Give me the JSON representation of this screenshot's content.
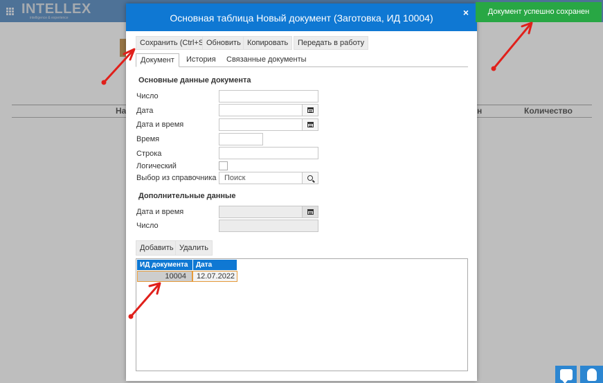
{
  "app": {
    "logo": "INTELLEX",
    "logo_tagline": "intelligence & experience"
  },
  "background": {
    "col_name_fragment": "На",
    "col_fragment_2": "н",
    "col_quantity": "Количество"
  },
  "modal": {
    "title": "Основная таблица Новый документ (Заготовка, ИД 10004)",
    "close": "×",
    "toolbar": {
      "save": "Сохранить (Ctrl+S)",
      "refresh": "Обновить",
      "copy": "Копировать",
      "send": "Передать в работу"
    },
    "tabs": [
      "Документ",
      "История",
      "Связанные документы"
    ],
    "main_section": "Основные данные документа",
    "fields": {
      "number": "Число",
      "date": "Дата",
      "datetime": "Дата и время",
      "time": "Время",
      "string": "Строка",
      "logical": "Логический",
      "lookup": "Выбор из справочника"
    },
    "search_placeholder": "Поиск",
    "extra_section": "Дополнительные данные",
    "extra_fields": {
      "datetime": "Дата и время",
      "number": "Число"
    },
    "grid_buttons": {
      "add": "Добавить",
      "delete": "Удалить"
    },
    "grid": {
      "columns": [
        "ИД документа",
        "Дата"
      ],
      "rows": [
        {
          "id": "10004",
          "date": "12.07.2022"
        }
      ]
    }
  },
  "toast": "Документ успешно сохранен",
  "colors": {
    "header_blue": "#0f78d3",
    "toast_green": "#28a744",
    "annotation_red": "#e0201b"
  }
}
